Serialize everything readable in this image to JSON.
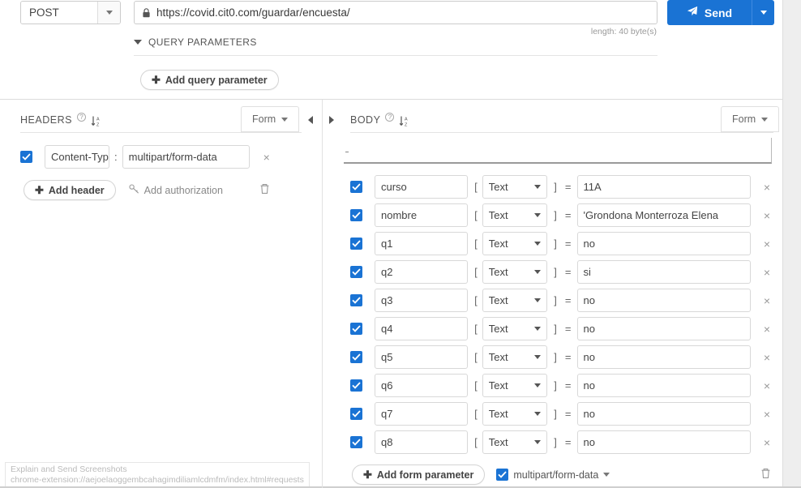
{
  "request": {
    "method": "POST",
    "method_caret_icon": "chevron-down-icon",
    "url": "https://covid.cit0.com/guardar/encuesta/",
    "url_lock_icon": "lock-icon",
    "length_note": "length: 40 byte(s)",
    "send_label": "Send",
    "send_icon": "paper-plane-icon",
    "send_caret_icon": "chevron-down-icon"
  },
  "query_parameters": {
    "toggle_icon": "triangle-down-icon",
    "title": "QUERY PARAMETERS",
    "add_label": "Add query parameter",
    "add_icon": "plus-icon"
  },
  "headers_panel": {
    "title": "HEADERS",
    "help_icon": "question-mark-icon",
    "sort_icon": "sort-az-icon",
    "format_label": "Form",
    "format_caret_icon": "chevron-down-icon",
    "collapse_icon": "triangle-left-icon",
    "rows": [
      {
        "enabled": true,
        "key": "Content-Typ",
        "separator": ":",
        "value": "multipart/form-data",
        "remove_label": "×"
      }
    ],
    "add_header_label": "Add header",
    "add_header_icon": "plus-icon",
    "add_authorization_label": "Add authorization",
    "add_authorization_icon": "key-icon",
    "delete_icon": "trash-icon"
  },
  "body_panel": {
    "expand_icon": "triangle-right-icon",
    "title": "BODY",
    "help_icon": "question-mark-icon",
    "sort_icon": "sort-az-icon",
    "format_label": "Form",
    "format_caret_icon": "chevron-down-icon",
    "type_options_visible": "Text",
    "brackets": {
      "open": "[",
      "close": "]",
      "equals": "="
    },
    "rows": [
      {
        "enabled": true,
        "key": "curso",
        "type": "Text",
        "value": "11A"
      },
      {
        "enabled": true,
        "key": "nombre",
        "type": "Text",
        "value": "'Grondona Monterroza Elena"
      },
      {
        "enabled": true,
        "key": "q1",
        "type": "Text",
        "value": "no"
      },
      {
        "enabled": true,
        "key": "q2",
        "type": "Text",
        "value": "si"
      },
      {
        "enabled": true,
        "key": "q3",
        "type": "Text",
        "value": "no"
      },
      {
        "enabled": true,
        "key": "q4",
        "type": "Text",
        "value": "no"
      },
      {
        "enabled": true,
        "key": "q5",
        "type": "Text",
        "value": "no"
      },
      {
        "enabled": true,
        "key": "q6",
        "type": "Text",
        "value": "no"
      },
      {
        "enabled": true,
        "key": "q7",
        "type": "Text",
        "value": "no"
      },
      {
        "enabled": true,
        "key": "q8",
        "type": "Text",
        "value": "no"
      }
    ],
    "remove_label": "×",
    "add_form_parameter_label": "Add form parameter",
    "add_form_parameter_icon": "plus-icon",
    "encoding_label": "multipart/form-data",
    "encoding_enabled": true,
    "encoding_caret_icon": "chevron-down-icon",
    "delete_icon": "trash-icon"
  },
  "statusbar": {
    "title": "Explain and Send Screenshots",
    "url": "chrome-extension://aejoelaoggembcahagimdiliamlcdmfm/index.html#requests"
  },
  "colors": {
    "accent": "#1a73d4",
    "send_button": "#1a73d4",
    "panel_border": "#e4e4e4",
    "input_border": "#d8d8d8",
    "muted_text": "#999999"
  }
}
